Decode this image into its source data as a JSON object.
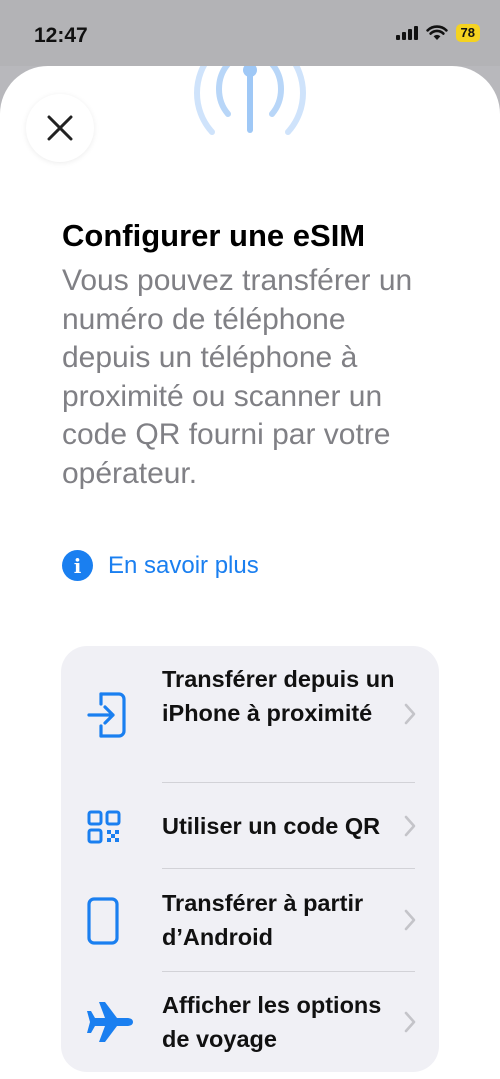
{
  "status_bar": {
    "time": "12:47",
    "battery": "78"
  },
  "sheet": {
    "title": "Configurer une eSIM",
    "description": "Vous pouvez transférer un numéro de téléphone depuis un téléphone à proximité ou scanner un code QR fourni par votre opérateur.",
    "learn_more": "En savoir plus"
  },
  "options": {
    "nearby_iphone": "Transférer depuis un iPhone à proximité",
    "qr_code": "Utiliser un code QR",
    "android": "Transférer à partir d’Android",
    "travel": "Afficher les options de voyage"
  },
  "colors": {
    "accent": "#1a7ff0",
    "battery": "#f5d320",
    "secondary_text": "#808085",
    "card_background": "#f0f0f5"
  }
}
